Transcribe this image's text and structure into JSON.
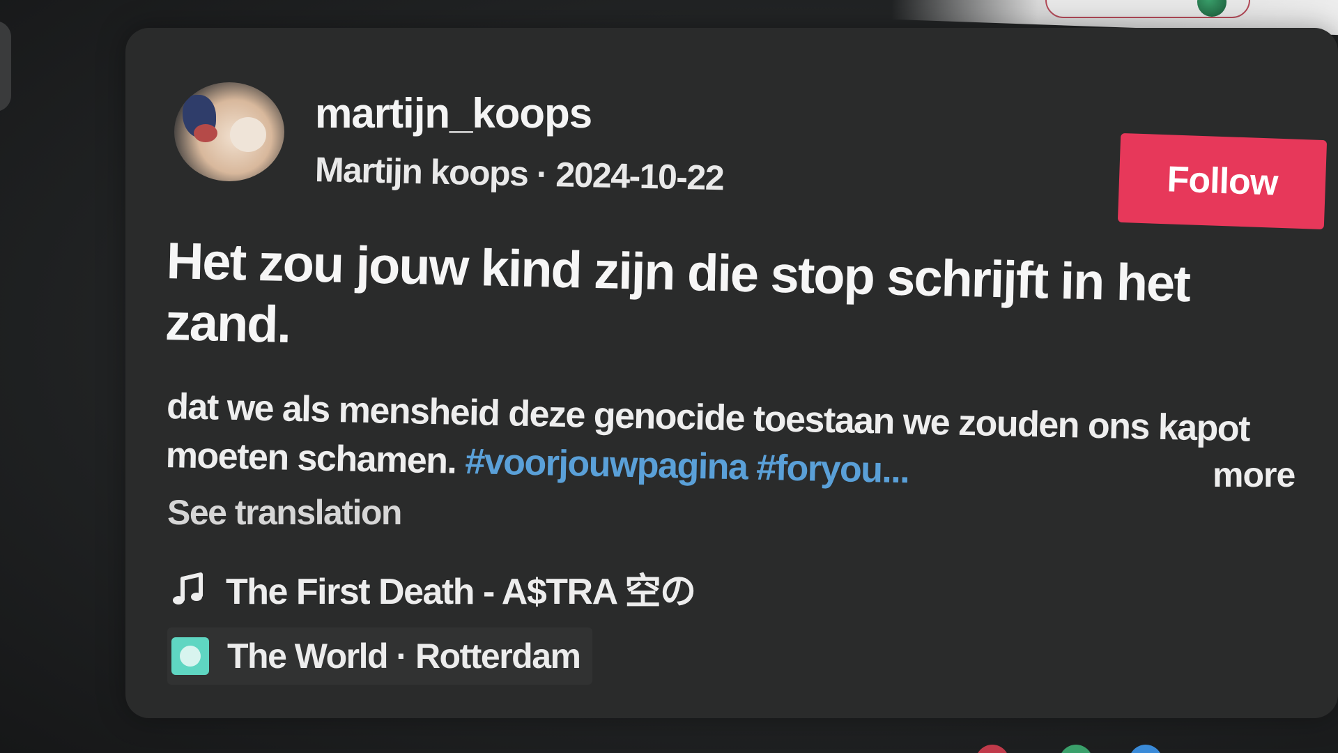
{
  "post": {
    "username": "martijn_koops",
    "display_name": "Martijn koops",
    "separator": "·",
    "date": "2024-10-22",
    "follow_label": "Follow",
    "title": "Het zou jouw kind zijn die stop schrijft in het zand.",
    "description_text": "dat we als mensheid deze genocide toestaan we zouden ons kapot moeten schamen.",
    "hashtags": "#voorjouwpagina #foryou...",
    "more_label": "more",
    "see_translation_label": "See translation",
    "music": "The First Death - A$TRA 空の",
    "location": "The World · Rotterdam"
  },
  "icons": {
    "music": "music-note-icon",
    "location": "location-pin-icon"
  },
  "colors": {
    "follow_button": "#e7385a",
    "hashtag": "#5aa0d8",
    "card_background": "#2a2b2b",
    "location_icon": "#5fd6c2"
  }
}
